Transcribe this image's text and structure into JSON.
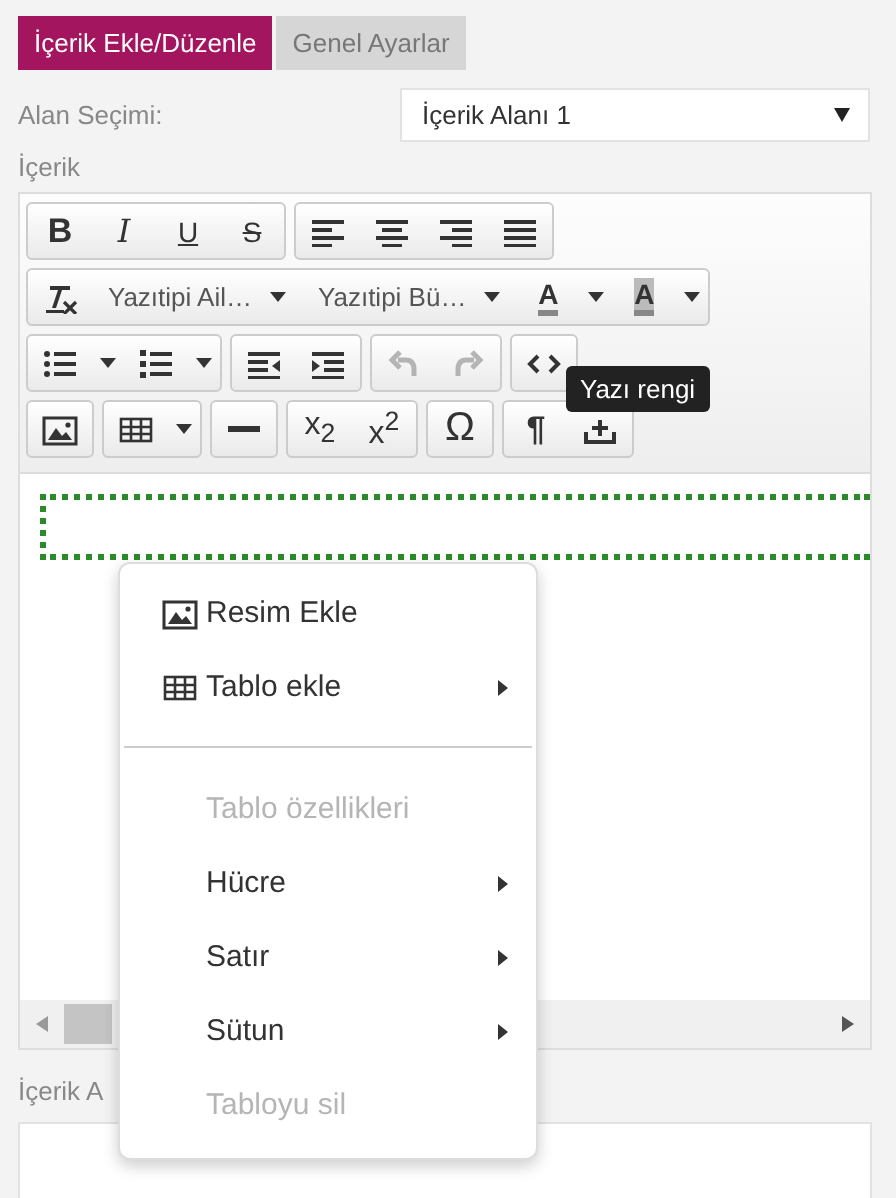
{
  "tabs": [
    {
      "label": "İçerik Ekle/Düzenle",
      "selected": true
    },
    {
      "label": "Genel Ayarlar",
      "selected": false
    }
  ],
  "area_select": {
    "label": "Alan Seçimi:",
    "value": "İçerik Alanı 1"
  },
  "content_label": "İçerik",
  "toolbar": [
    [
      [
        {
          "kind": "bold",
          "glyph": "B"
        },
        {
          "kind": "italic",
          "glyph": "I"
        },
        {
          "kind": "underline",
          "glyph": "U"
        },
        {
          "kind": "strike",
          "glyph": "S"
        }
      ],
      [
        {
          "kind": "alignleft"
        },
        {
          "kind": "aligncenter"
        },
        {
          "kind": "alignright"
        },
        {
          "kind": "justify"
        }
      ]
    ],
    [
      [
        {
          "kind": "clearformat"
        },
        {
          "kind": "select",
          "label": "Yazıtipi Ail…"
        },
        {
          "kind": "select",
          "label": "Yazıtipi Bü…"
        },
        {
          "kind": "forecolor",
          "glyph": "A",
          "dropdown": true
        },
        {
          "kind": "backcolor",
          "glyph": "A",
          "dropdown": true
        }
      ]
    ],
    [
      [
        {
          "kind": "bullist",
          "dropdown": true
        },
        {
          "kind": "numlist",
          "dropdown": true
        }
      ],
      [
        {
          "kind": "outdent"
        },
        {
          "kind": "indent"
        }
      ],
      [
        {
          "kind": "undo",
          "disabled": true
        },
        {
          "kind": "redo",
          "disabled": true
        }
      ],
      [
        {
          "kind": "code"
        }
      ]
    ],
    [
      [
        {
          "kind": "image"
        }
      ],
      [
        {
          "kind": "table",
          "dropdown": true
        }
      ],
      [
        {
          "kind": "hr"
        }
      ],
      [
        {
          "kind": "subscript",
          "glyph": "x$_{2}$"
        },
        {
          "kind": "superscript",
          "glyph": "x$^{2}$"
        }
      ],
      [
        {
          "kind": "symbol",
          "glyph": "Ω"
        }
      ],
      [
        {
          "kind": "paragraph",
          "glyph": "¶"
        },
        {
          "kind": "upload"
        }
      ]
    ]
  ],
  "tooltip": "Yazı rengi",
  "second_label": "İçerik A",
  "context_menu": [
    {
      "kind": "image",
      "label": "Resim Ekle",
      "submenu": false,
      "disabled": false
    },
    {
      "kind": "table",
      "label": "Tablo ekle",
      "submenu": true,
      "disabled": false
    },
    {
      "kind": "separator"
    },
    {
      "kind": "item",
      "label": "Tablo özellikleri",
      "submenu": false,
      "disabled": true
    },
    {
      "kind": "item",
      "label": "Hücre",
      "submenu": true,
      "disabled": false
    },
    {
      "kind": "item",
      "label": "Satır",
      "submenu": true,
      "disabled": false
    },
    {
      "kind": "item",
      "label": "Sütun",
      "submenu": true,
      "disabled": false
    },
    {
      "kind": "item",
      "label": "Tabloyu sil",
      "submenu": false,
      "disabled": true
    }
  ]
}
